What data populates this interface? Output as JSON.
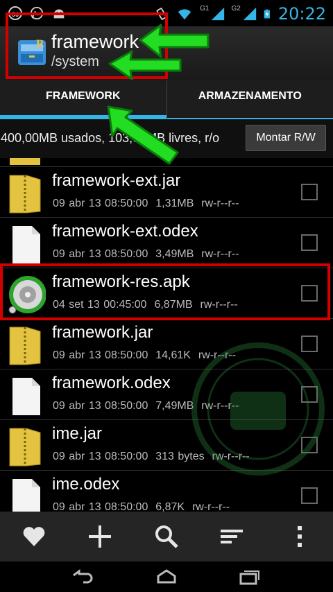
{
  "status_bar": {
    "notification_count": "56",
    "sim1_label": "G1",
    "sim2_label": "G2",
    "time": "20:22"
  },
  "action_bar": {
    "title": "framework",
    "subtitle": "/system"
  },
  "tabs": [
    {
      "label": "FRAMEWORK",
      "active": true
    },
    {
      "label": "ARMAZENAMENTO",
      "active": false
    }
  ],
  "storage_info": {
    "text": "400,00MB usados, 103,00MB livres, r/o",
    "mount_button": "Montar R/W"
  },
  "files": [
    {
      "name": "framework-ext.jar",
      "date": "09 abr 13 08:50:00",
      "size": "1,31MB",
      "perms": "rw-r--r--",
      "icon": "zip-archive-icon"
    },
    {
      "name": "framework-ext.odex",
      "date": "09 abr 13 08:50:00",
      "size": "3,49MB",
      "perms": "rw-r--r--",
      "icon": "document-icon"
    },
    {
      "name": "framework-res.apk",
      "date": "04 set 13 00:45:00",
      "size": "6,87MB",
      "perms": "rw-r--r--",
      "icon": "apk-icon"
    },
    {
      "name": "framework.jar",
      "date": "09 abr 13 08:50:00",
      "size": "14,61K",
      "perms": "rw-r--r--",
      "icon": "zip-archive-icon"
    },
    {
      "name": "framework.odex",
      "date": "09 abr 13 08:50:00",
      "size": "7,49MB",
      "perms": "rw-r--r--",
      "icon": "document-icon"
    },
    {
      "name": "ime.jar",
      "date": "09 abr 13 08:50:00",
      "size": "313 bytes",
      "perms": "rw-r--r--",
      "icon": "zip-archive-icon"
    },
    {
      "name": "ime.odex",
      "date": "09 abr 13 08:50:00",
      "size": "6,87K",
      "perms": "rw-r--r--",
      "icon": "document-icon"
    }
  ],
  "toolbar": {
    "items": [
      "favorites-heart-icon",
      "add-plus-icon",
      "search-icon",
      "sort-icon",
      "overflow-menu-icon"
    ]
  },
  "navigation": {
    "items": [
      "back-icon",
      "home-icon",
      "recent-apps-icon"
    ]
  },
  "colors": {
    "accent": "#33b5e5",
    "annotation_red": "#d40000",
    "annotation_arrow": "#22dd22",
    "zip_yellow": "#e3c340"
  }
}
